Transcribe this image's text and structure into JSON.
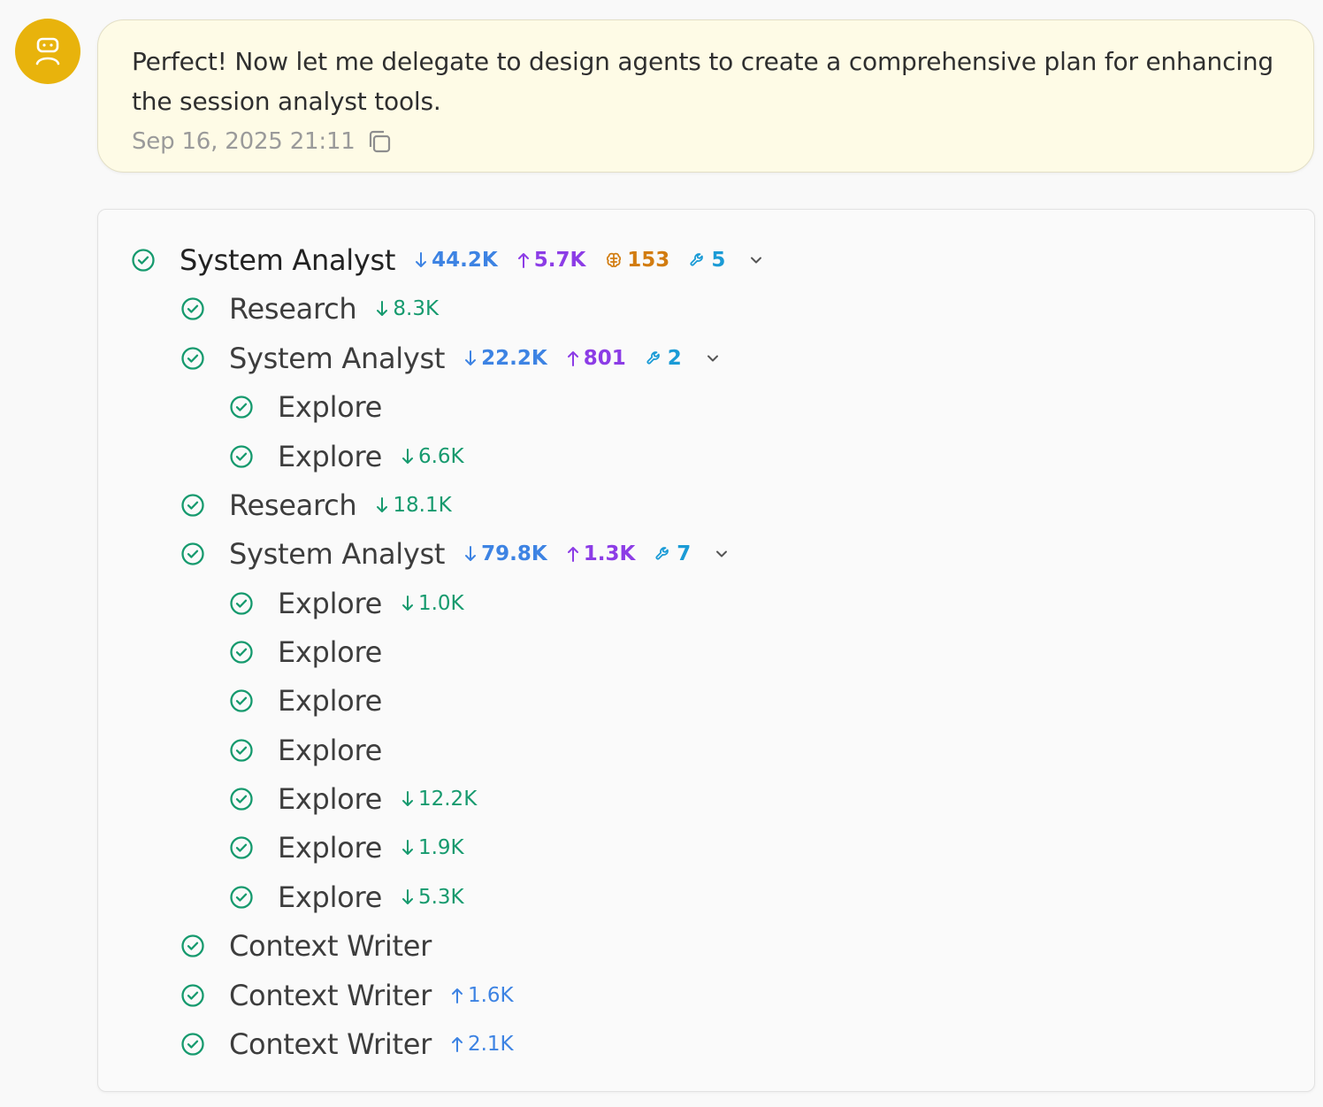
{
  "message": {
    "text": "Perfect! Now let me delegate to design agents to create a comprehensive plan for enhancing the session analyst tools.",
    "timestamp": "Sep 16, 2025 21:11"
  },
  "colors": {
    "avatar": "#e8b30c",
    "bubble_bg": "#fefbe6",
    "success": "#169a6e",
    "input_tokens": "#3d83e3",
    "output_tokens": "#8c3ce6",
    "thinking": "#d27c10",
    "tools": "#1a9bd6"
  },
  "agents": [
    {
      "name": "System Analyst",
      "in": "44.2K",
      "out": "5.7K",
      "think": "153",
      "tools": "5"
    },
    {
      "name": "Research",
      "in": "8.3K"
    },
    {
      "name": "System Analyst",
      "in": "22.2K",
      "out": "801",
      "tools": "2"
    },
    {
      "name": "Explore"
    },
    {
      "name": "Explore",
      "in": "6.6K"
    },
    {
      "name": "Research",
      "in": "18.1K"
    },
    {
      "name": "System Analyst",
      "in": "79.8K",
      "out": "1.3K",
      "tools": "7"
    },
    {
      "name": "Explore",
      "in": "1.0K"
    },
    {
      "name": "Explore"
    },
    {
      "name": "Explore"
    },
    {
      "name": "Explore"
    },
    {
      "name": "Explore",
      "in": "12.2K"
    },
    {
      "name": "Explore",
      "in": "1.9K"
    },
    {
      "name": "Explore",
      "in": "5.3K"
    },
    {
      "name": "Context Writer"
    },
    {
      "name": "Context Writer",
      "out": "1.6K"
    },
    {
      "name": "Context Writer",
      "out": "2.1K"
    }
  ]
}
